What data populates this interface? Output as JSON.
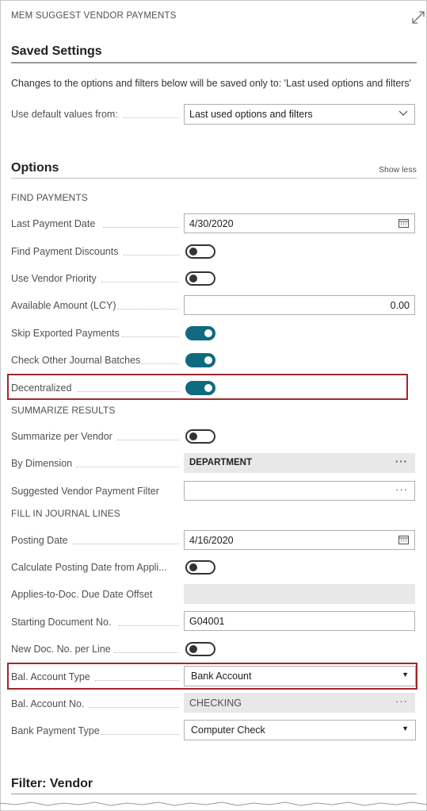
{
  "page": {
    "title": "MEM SUGGEST VENDOR PAYMENTS"
  },
  "saved_settings": {
    "title": "Saved Settings",
    "note": "Changes to the options and filters below will be saved only to: 'Last used options and filters'",
    "use_default_label": "Use default values from:",
    "use_default_value": "Last used options and filters"
  },
  "options": {
    "title": "Options",
    "show_less": "Show less",
    "find_payments": {
      "heading": "FIND PAYMENTS",
      "last_payment_date_label": "Last Payment Date",
      "last_payment_date_value": "4/30/2020",
      "find_payment_discounts_label": "Find Payment Discounts",
      "find_payment_discounts_on": false,
      "use_vendor_priority_label": "Use Vendor Priority",
      "use_vendor_priority_on": false,
      "available_amount_label": "Available Amount (LCY)",
      "available_amount_value": "0.00",
      "skip_exported_label": "Skip Exported Payments",
      "skip_exported_on": true,
      "check_other_batches_label": "Check Other Journal Batches",
      "check_other_batches_on": true,
      "decentralized_label": "Decentralized",
      "decentralized_on": true
    },
    "summarize_results": {
      "heading": "SUMMARIZE RESULTS",
      "summarize_per_vendor_label": "Summarize per Vendor",
      "summarize_per_vendor_on": false,
      "by_dimension_label": "By Dimension",
      "by_dimension_value": "DEPARTMENT",
      "suggested_filter_label": "Suggested Vendor Payment Filter",
      "suggested_filter_value": ""
    },
    "fill_in_journal_lines": {
      "heading": "FILL IN JOURNAL LINES",
      "posting_date_label": "Posting Date",
      "posting_date_value": "4/16/2020",
      "calc_posting_date_label": "Calculate Posting Date from Appli...",
      "calc_posting_date_on": false,
      "applies_to_doc_label": "Applies-to-Doc. Due Date Offset",
      "applies_to_doc_value": "",
      "starting_doc_no_label": "Starting Document No.",
      "starting_doc_no_value": "G04001",
      "new_doc_no_label": "New Doc. No. per Line",
      "new_doc_no_on": false,
      "bal_account_type_label": "Bal. Account Type",
      "bal_account_type_value": "Bank Account",
      "bal_account_no_label": "Bal. Account No.",
      "bal_account_no_value": "CHECKING",
      "bank_payment_type_label": "Bank Payment Type",
      "bank_payment_type_value": "Computer Check"
    }
  },
  "filter_vendor": {
    "title": "Filter: Vendor"
  },
  "icons": {
    "expand": "expand-icon",
    "calendar": "calendar-icon",
    "chevron": "chevron-down-icon",
    "caret": "caret-down-icon",
    "ellipsis": "ellipsis-icon"
  },
  "colors": {
    "toggle_on": "#0f6a7f",
    "highlight": "#a4262c"
  }
}
